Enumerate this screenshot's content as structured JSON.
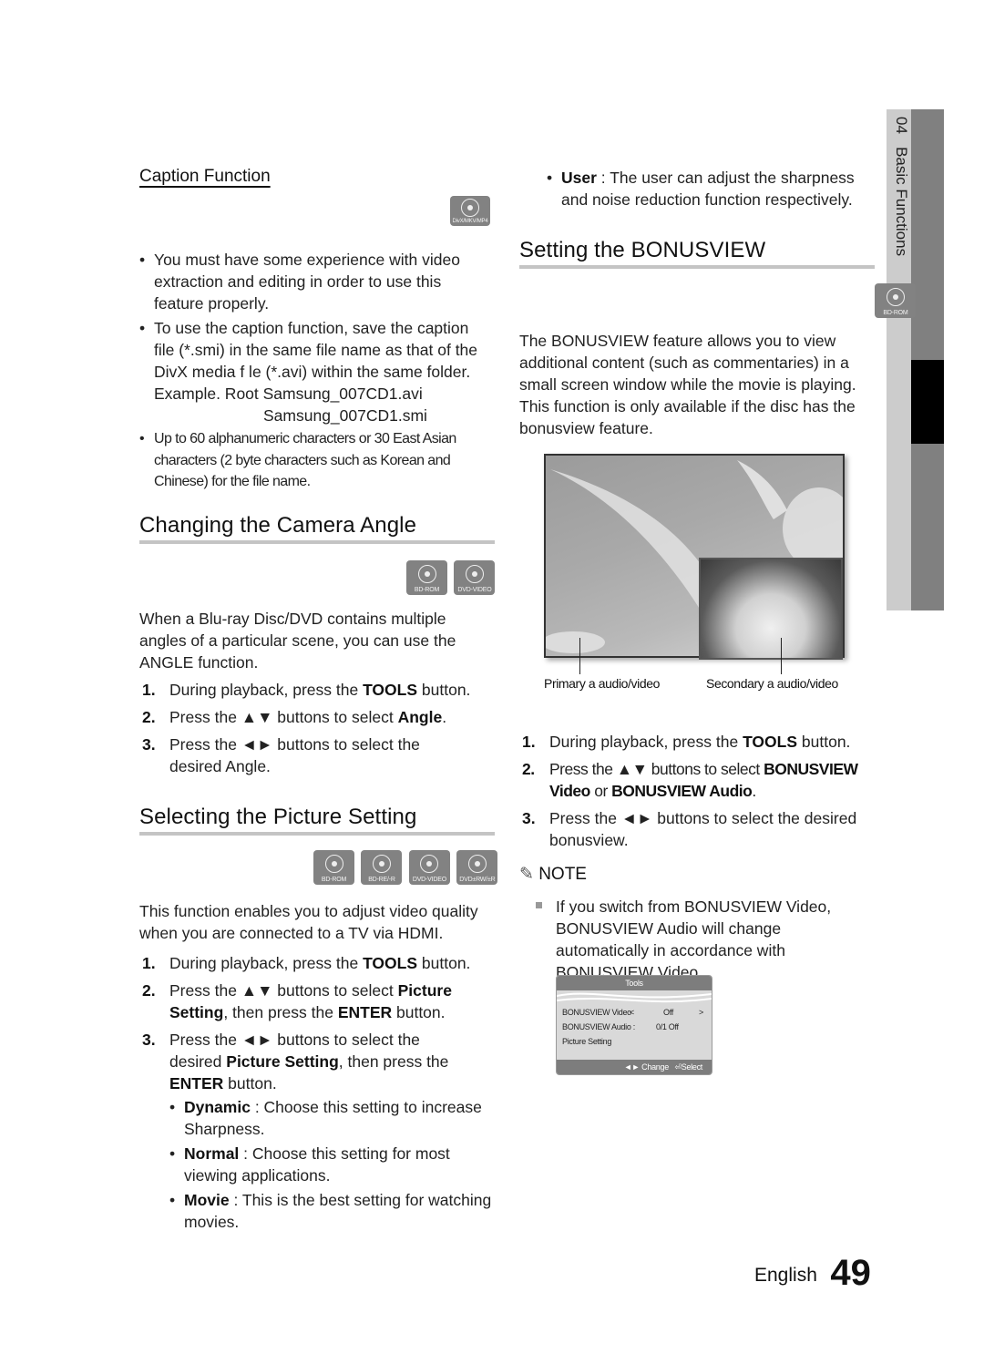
{
  "side_tab": {
    "chapter_number": "04",
    "chapter_title": "Basic Functions"
  },
  "caption_function": {
    "title": "Caption Function",
    "badge": "DivX/MKV/MP4",
    "bullets": [
      "You must have some experience with video extraction and editing in order to use this feature properly.",
      "To use the caption function, save the caption file (*.smi) in the same file name as that of the DivX media f le (*.avi) within the same folder.",
      "Up to 60 alphanumeric characters or 30 East Asian characters (2 byte characters such as Korean and Chinese) for the file name."
    ],
    "example_line1": "Example. Root Samsung_007CD1.avi",
    "example_line2": "Samsung_007CD1.smi"
  },
  "camera_angle": {
    "title": "Changing the Camera Angle",
    "badges": [
      "BD-ROM",
      "DVD-VIDEO"
    ],
    "intro": "When a Blu-ray Disc/DVD contains multiple angles of a particular scene, you can use the ANGLE function.",
    "steps": [
      {
        "num": "1.",
        "pre": "During playback, press the ",
        "bold": "TOOLS",
        "post": " button."
      },
      {
        "num": "2.",
        "pre": "Press the ▲▼ buttons to select ",
        "bold": "Angle",
        "post": "."
      },
      {
        "num": "3.",
        "pre": "Press the ◄► buttons to select the desired Angle.",
        "bold": "",
        "post": ""
      }
    ]
  },
  "picture_setting": {
    "title": "Selecting the Picture Setting",
    "badges": [
      "BD-ROM",
      "BD-RE/-R",
      "DVD-VIDEO",
      "DVD±RW/±R"
    ],
    "intro": "This function enables you to adjust video quality when you are connected to a TV via HDMI.",
    "step1": {
      "num": "1.",
      "pre": "During playback, press the ",
      "bold": "TOOLS",
      "post": " button."
    },
    "step2": {
      "num": "2.",
      "pre": "Press the ▲▼ buttons to select ",
      "bold1": "Picture Setting",
      "mid": ", then press the ",
      "bold2": "ENTER",
      "post": " button."
    },
    "step3": {
      "num": "3.",
      "pre": "Press the ◄► buttons to select the desired ",
      "bold1": "Picture Setting",
      "mid": ", then press the ",
      "bold2": "ENTER",
      "post": " button."
    },
    "options": [
      {
        "name": "Dynamic",
        "desc": " : Choose this setting to increase Sharpness."
      },
      {
        "name": "Normal",
        "desc": " : Choose this setting for most viewing applications."
      },
      {
        "name": "Movie",
        "desc": " : This is the best setting for watching movies."
      },
      {
        "name": "User",
        "desc": " : The user can adjust the sharpness and noise reduction function respectively."
      }
    ]
  },
  "bonusview": {
    "title": "Setting the BONUSVIEW",
    "badge": "BD-ROM",
    "intro": "The BONUSVIEW feature allows you to view additional content (such as commentaries) in a small screen window while the movie is playing. This function is only available if the disc has the bonusview feature.",
    "figure": {
      "primary_label": "Primary a audio/video",
      "secondary_label": "Secondary a audio/video"
    },
    "step1": {
      "num": "1.",
      "pre": "During playback, press the ",
      "bold": "TOOLS",
      "post": " button."
    },
    "step2": {
      "num": "2.",
      "pre": "Press the ▲▼ buttons to select ",
      "bold1": "BONUSVIEW Video",
      "mid": " or ",
      "bold2": "BONUSVIEW Audio",
      "post": "."
    },
    "step3": {
      "num": "3.",
      "text": "Press the ◄► buttons to select the desired bonusview."
    },
    "note_title": "NOTE",
    "note_text": "If you switch from BONUSVIEW Video, BONUSVIEW Audio will change automatically in accordance with BONUSVIEW Video.",
    "tools_menu": {
      "title": "Tools",
      "rows": [
        {
          "label": "BONUSVIEW Video",
          "left": "<",
          "value": "Off",
          "right": ">"
        },
        {
          "label": "BONUSVIEW Audio :",
          "left": "",
          "value": "0/1 Off",
          "right": ""
        },
        {
          "label": "Picture Setting",
          "left": "",
          "value": "",
          "right": ""
        }
      ],
      "footer_change": "◄► Change",
      "footer_select": "Select"
    }
  },
  "footer": {
    "language": "English",
    "page_number": "49"
  }
}
